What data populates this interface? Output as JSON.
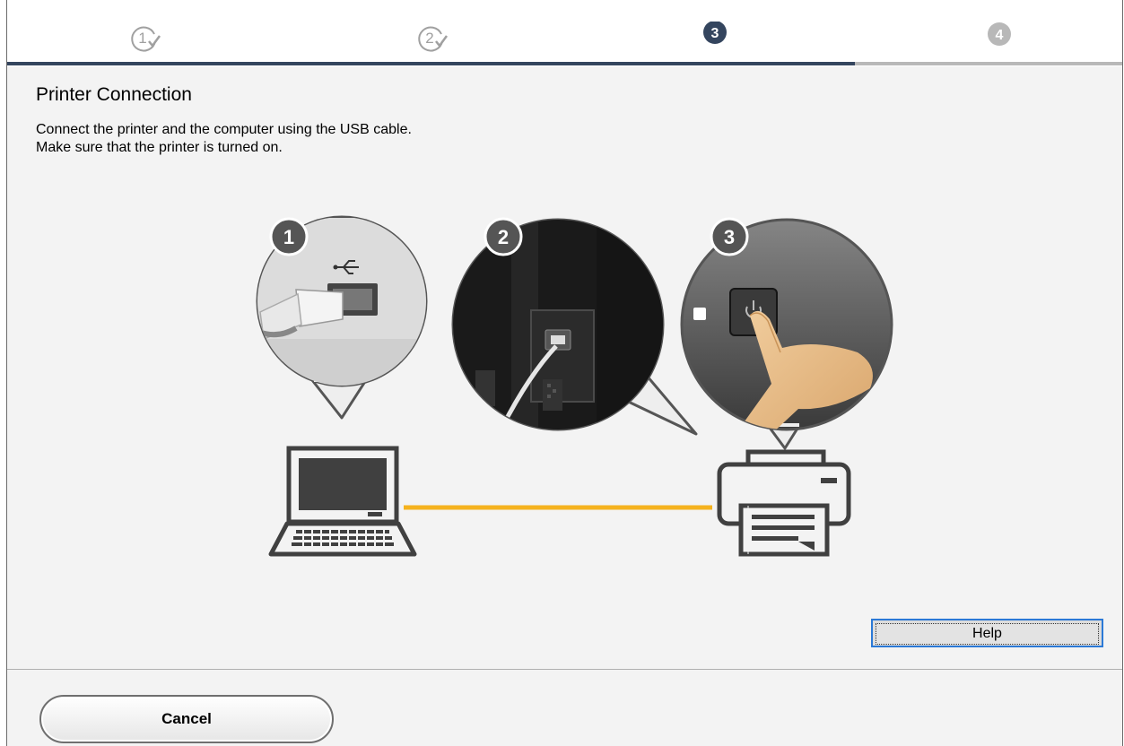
{
  "stepper": {
    "steps": [
      {
        "label": "1",
        "state": "done"
      },
      {
        "label": "2",
        "state": "done"
      },
      {
        "label": "3",
        "state": "current"
      },
      {
        "label": "4",
        "state": "pending"
      }
    ],
    "progress_fraction": 0.76
  },
  "page": {
    "title": "Printer Connection",
    "line1": "Connect the printer and the computer using the USB cable.",
    "line2": "Make sure that the printer is turned on."
  },
  "illustration": {
    "callouts": [
      "1",
      "2",
      "3"
    ],
    "cable_color": "#f5b21e"
  },
  "buttons": {
    "help_label": "Help",
    "cancel_label": "Cancel"
  },
  "colors": {
    "accent": "#34455e",
    "inactive": "#b8b8b8",
    "focus": "#2b79d6"
  }
}
